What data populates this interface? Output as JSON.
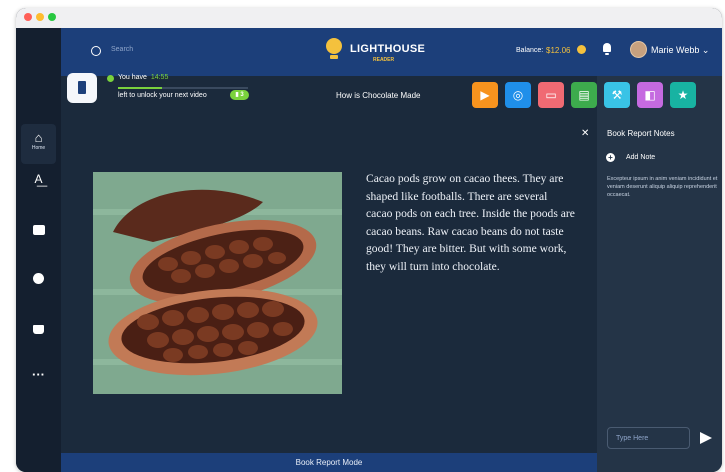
{
  "header": {
    "search_placeholder": "Search",
    "logo_title": "LIGHTHOUSE",
    "logo_subtitle": "READER",
    "balance_label": "Balance:",
    "balance_value": "$12.06",
    "user_name": "Marie Webb"
  },
  "sidebar": {
    "items": [
      {
        "label": "Home",
        "icon": "home-icon"
      },
      {
        "label": "",
        "icon": "text-icon"
      },
      {
        "label": "",
        "icon": "chat-icon"
      },
      {
        "label": "",
        "icon": "settings-icon"
      },
      {
        "label": "",
        "icon": "cart-icon"
      },
      {
        "label": "",
        "icon": "more-icon"
      }
    ]
  },
  "timer": {
    "prefix": "You have",
    "time": "14:55",
    "suffix": "left to unlock your next video",
    "badge": "3",
    "progress": 0.34
  },
  "lesson": {
    "title": "How is Chocolate Made",
    "text": "Cacao pods grow on cacao thees. They are shaped like footballs. There are several cacao pods on each tree. Inside the poods are cacao beans. Raw cacao beans do not taste good! They are bitter. But with some work, they will turn into chocolate."
  },
  "toolbar": {
    "buttons": [
      {
        "icon": "play-icon",
        "color": "#f7931e"
      },
      {
        "icon": "hearing-icon",
        "color": "#1f8fea"
      },
      {
        "icon": "comment-icon",
        "color": "#f06a73"
      },
      {
        "icon": "book-icon",
        "color": "#3dab4d"
      },
      {
        "icon": "wrench-icon",
        "color": "#39c3e6"
      },
      {
        "icon": "label-icon",
        "color": "#c56ae0"
      },
      {
        "icon": "star-icon",
        "color": "#18b3a2"
      }
    ]
  },
  "notes": {
    "title": "Book Report Notes",
    "add_label": "Add Note",
    "body": "Excepteur ipsum in anim veniam incididunt et veniam deserunt aliquip aliquip reprehenderit occaecat.",
    "input_placeholder": "Type Here"
  },
  "footer": {
    "mode_label": "Book Report Mode"
  },
  "colors": {
    "topbar": "#1c3f7a",
    "accent_green": "#7ad23d",
    "coin": "#f4c13d"
  }
}
